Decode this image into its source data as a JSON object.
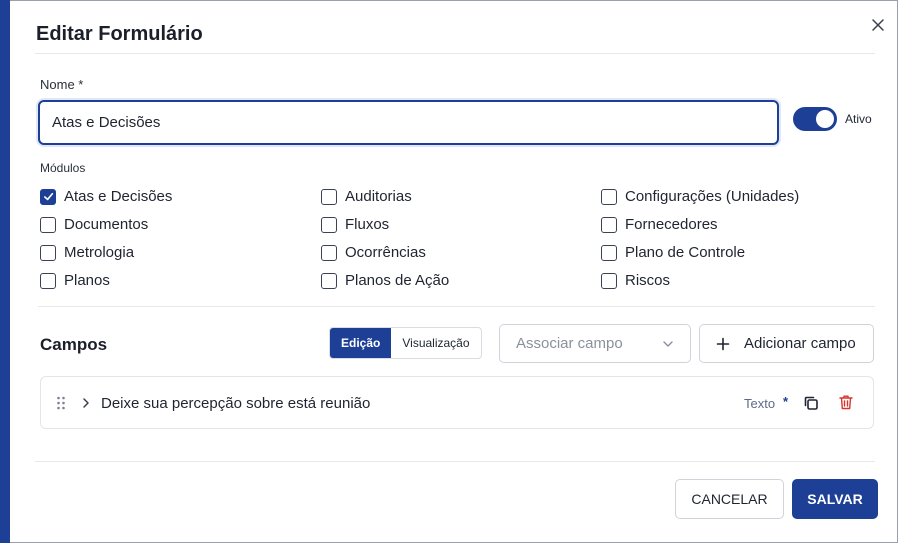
{
  "dialog": {
    "title": "Editar Formulário"
  },
  "name_field": {
    "label": "Nome *",
    "value": "Atas e Decisões"
  },
  "active_toggle": {
    "label": "Ativo",
    "on": true
  },
  "modules": {
    "label": "Módulos",
    "items": [
      {
        "label": "Atas e Decisões",
        "checked": true
      },
      {
        "label": "Auditorias",
        "checked": false
      },
      {
        "label": "Configurações (Unidades)",
        "checked": false
      },
      {
        "label": "Documentos",
        "checked": false
      },
      {
        "label": "Fluxos",
        "checked": false
      },
      {
        "label": "Fornecedores",
        "checked": false
      },
      {
        "label": "Metrologia",
        "checked": false
      },
      {
        "label": "Ocorrências",
        "checked": false
      },
      {
        "label": "Plano de Controle",
        "checked": false
      },
      {
        "label": "Planos",
        "checked": false
      },
      {
        "label": "Planos de Ação",
        "checked": false
      },
      {
        "label": "Riscos",
        "checked": false
      }
    ]
  },
  "fields_section": {
    "title": "Campos",
    "view_toggle": [
      {
        "label": "Edição",
        "active": true
      },
      {
        "label": "Visualização",
        "active": false
      }
    ],
    "associate_select": {
      "placeholder": "Associar campo"
    },
    "add_button": "Adicionar campo",
    "fields": [
      {
        "label": "Deixe sua percepção sobre está reunião",
        "type": "Texto",
        "required_mark": "*"
      }
    ]
  },
  "footer": {
    "cancel": "CANCELAR",
    "save": "SALVAR"
  },
  "colors": {
    "primary": "#1d3f96",
    "delete": "#d9342b"
  },
  "icons": [
    "close-icon",
    "check-icon",
    "chevron-down-icon",
    "plus-icon",
    "drag-handle-icon",
    "chevron-right-icon",
    "copy-icon",
    "trash-icon"
  ]
}
